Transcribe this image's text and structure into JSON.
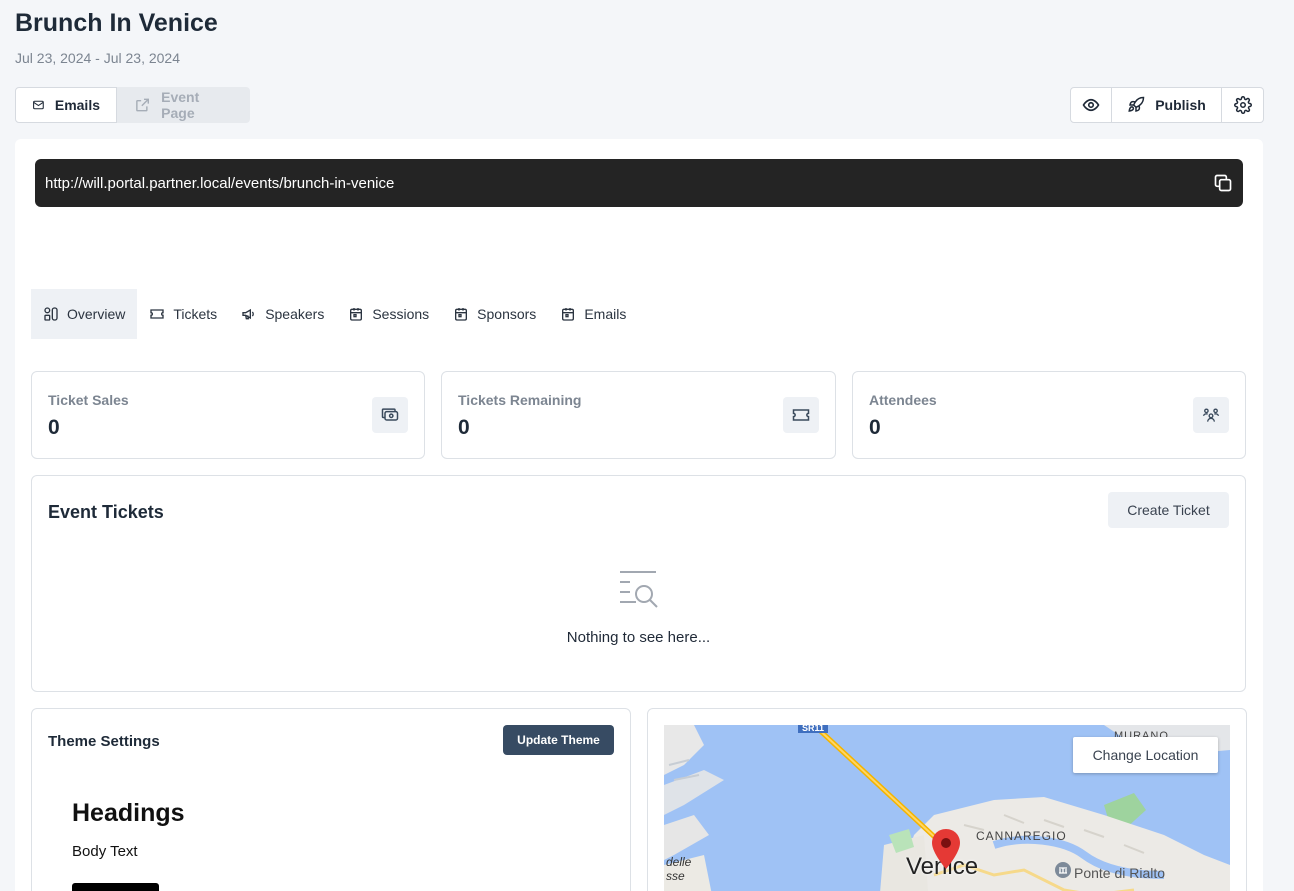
{
  "event": {
    "title": "Brunch In Venice",
    "dates": "Jul 23, 2024 - Jul 23, 2024"
  },
  "toolbar": {
    "emails_label": "Emails",
    "event_page_label": "Event Page",
    "publish_label": "Publish"
  },
  "url_bar": {
    "url": "http://will.portal.partner.local/events/brunch-in-venice"
  },
  "tabs": [
    {
      "label": "Overview",
      "icon": "overview-icon",
      "active": true
    },
    {
      "label": "Tickets",
      "icon": "ticket-icon",
      "active": false
    },
    {
      "label": "Speakers",
      "icon": "megaphone-icon",
      "active": false
    },
    {
      "label": "Sessions",
      "icon": "calendar-icon",
      "active": false
    },
    {
      "label": "Sponsors",
      "icon": "calendar-icon",
      "active": false
    },
    {
      "label": "Emails",
      "icon": "calendar-icon",
      "active": false
    }
  ],
  "stats": [
    {
      "label": "Ticket Sales",
      "value": "0",
      "icon": "cash-icon"
    },
    {
      "label": "Tickets Remaining",
      "value": "0",
      "icon": "ticket-icon"
    },
    {
      "label": "Attendees",
      "value": "0",
      "icon": "users-icon"
    }
  ],
  "event_tickets": {
    "title": "Event Tickets",
    "create_label": "Create Ticket",
    "empty_text": "Nothing to see here..."
  },
  "theme": {
    "title": "Theme Settings",
    "update_label": "Update Theme",
    "headings_sample": "Headings",
    "body_sample": "Body Text"
  },
  "map": {
    "change_location_label": "Change Location",
    "labels": {
      "city": "Venice",
      "district": "CANNAREGIO",
      "island": "MURANO",
      "poi": "Ponte di Rialto",
      "route": "SR11",
      "partial_1": "delle",
      "partial_2": "sse"
    }
  },
  "colors": {
    "accent_dark": "#374b63",
    "url_bar_bg": "#242424",
    "page_bg": "#f4f6f9",
    "map_water": "#9fc2f5",
    "map_pin": "#e53935"
  }
}
